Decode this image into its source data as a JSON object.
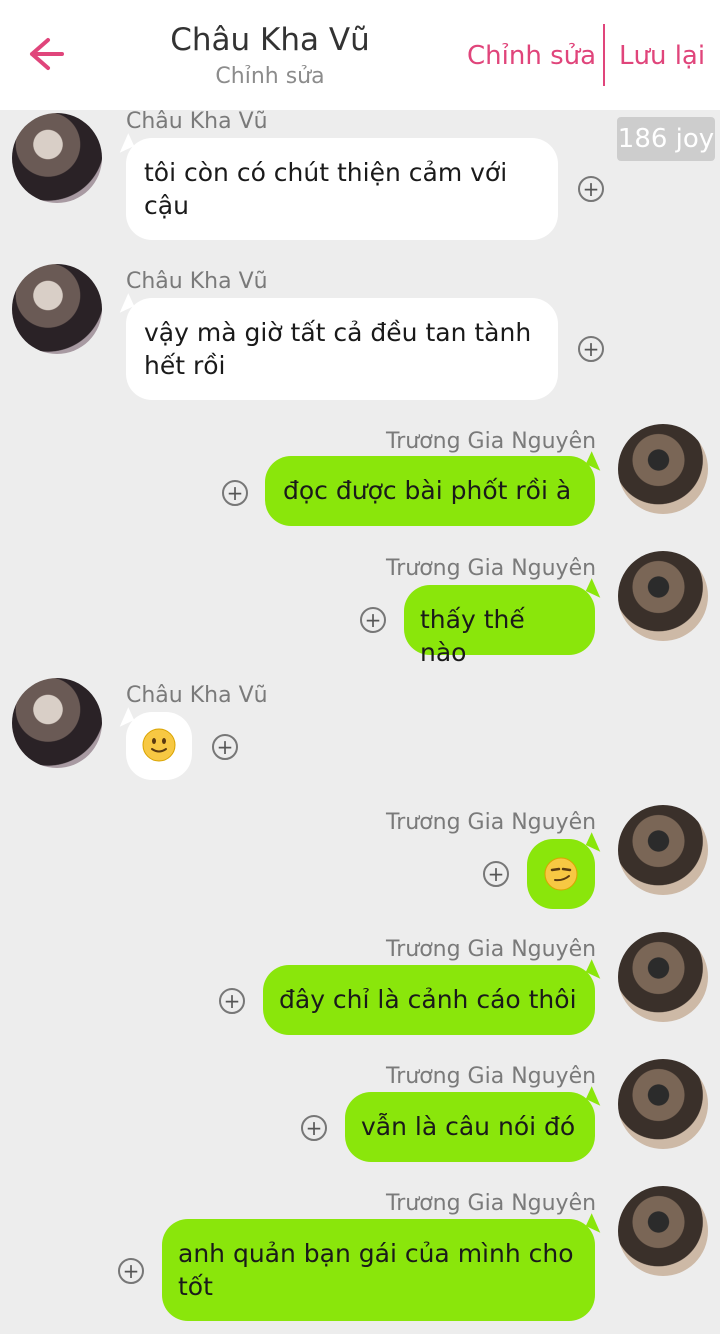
{
  "header": {
    "title": "Châu Kha Vũ",
    "subtitle": "Chỉnh sửa",
    "edit_button": "Chỉnh sửa",
    "save_button": "Lưu lại",
    "back_icon": "arrow-left-icon",
    "accent_color": "#e0457b"
  },
  "joy_badge": "186 joy",
  "messages": [
    {
      "sender": "Châu Kha Vũ",
      "side": "left",
      "text": "tôi còn có chút thiện cảm với cậu"
    },
    {
      "sender": "Châu Kha Vũ",
      "side": "left",
      "text": "vậy mà giờ tất cả đều tan tành hết rồi"
    },
    {
      "sender": "Trương Gia Nguyên",
      "side": "right",
      "text": "đọc được bài phốt rồi à"
    },
    {
      "sender": "Trương Gia Nguyên",
      "side": "right",
      "text": "thấy thế nào"
    },
    {
      "sender": "Châu Kha Vũ",
      "side": "left",
      "text": "🙂",
      "emoji": "slight-smile"
    },
    {
      "sender": "Trương Gia Nguyên",
      "side": "right",
      "text": "😏",
      "emoji": "smirk"
    },
    {
      "sender": "Trương Gia Nguyên",
      "side": "right",
      "text": "đây chỉ là cảnh cáo thôi"
    },
    {
      "sender": "Trương Gia Nguyên",
      "side": "right",
      "text": "vẫn là câu nói đó"
    },
    {
      "sender": "Trương Gia Nguyên",
      "side": "right",
      "text": "anh quản bạn gái của mình cho tốt"
    }
  ],
  "colors": {
    "background": "#ededed",
    "incoming_bubble": "#ffffff",
    "outgoing_bubble": "#8ae60b"
  }
}
